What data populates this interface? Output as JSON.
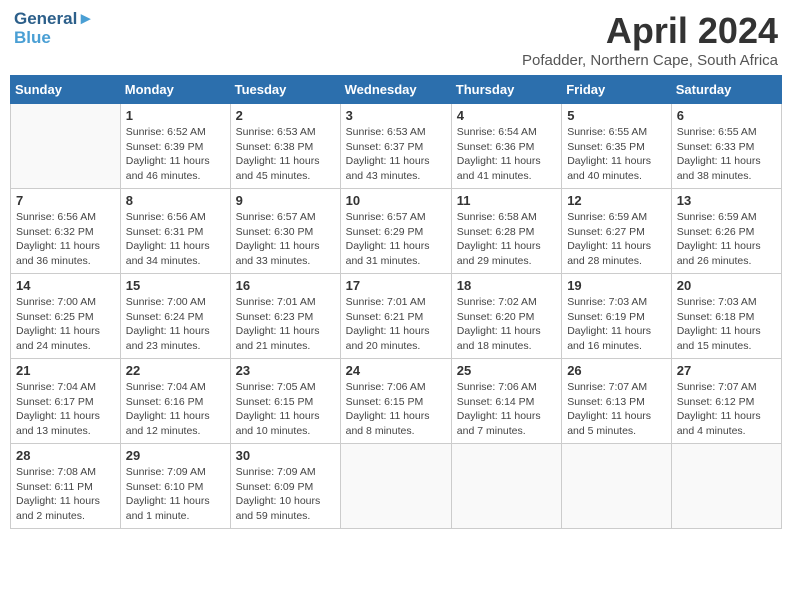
{
  "logo": {
    "line1": "General",
    "line2": "Blue",
    "arrow": "▶"
  },
  "title": "April 2024",
  "location": "Pofadder, Northern Cape, South Africa",
  "days_of_week": [
    "Sunday",
    "Monday",
    "Tuesday",
    "Wednesday",
    "Thursday",
    "Friday",
    "Saturday"
  ],
  "weeks": [
    [
      {
        "day": "",
        "info": ""
      },
      {
        "day": "1",
        "info": "Sunrise: 6:52 AM\nSunset: 6:39 PM\nDaylight: 11 hours\nand 46 minutes."
      },
      {
        "day": "2",
        "info": "Sunrise: 6:53 AM\nSunset: 6:38 PM\nDaylight: 11 hours\nand 45 minutes."
      },
      {
        "day": "3",
        "info": "Sunrise: 6:53 AM\nSunset: 6:37 PM\nDaylight: 11 hours\nand 43 minutes."
      },
      {
        "day": "4",
        "info": "Sunrise: 6:54 AM\nSunset: 6:36 PM\nDaylight: 11 hours\nand 41 minutes."
      },
      {
        "day": "5",
        "info": "Sunrise: 6:55 AM\nSunset: 6:35 PM\nDaylight: 11 hours\nand 40 minutes."
      },
      {
        "day": "6",
        "info": "Sunrise: 6:55 AM\nSunset: 6:33 PM\nDaylight: 11 hours\nand 38 minutes."
      }
    ],
    [
      {
        "day": "7",
        "info": "Sunrise: 6:56 AM\nSunset: 6:32 PM\nDaylight: 11 hours\nand 36 minutes."
      },
      {
        "day": "8",
        "info": "Sunrise: 6:56 AM\nSunset: 6:31 PM\nDaylight: 11 hours\nand 34 minutes."
      },
      {
        "day": "9",
        "info": "Sunrise: 6:57 AM\nSunset: 6:30 PM\nDaylight: 11 hours\nand 33 minutes."
      },
      {
        "day": "10",
        "info": "Sunrise: 6:57 AM\nSunset: 6:29 PM\nDaylight: 11 hours\nand 31 minutes."
      },
      {
        "day": "11",
        "info": "Sunrise: 6:58 AM\nSunset: 6:28 PM\nDaylight: 11 hours\nand 29 minutes."
      },
      {
        "day": "12",
        "info": "Sunrise: 6:59 AM\nSunset: 6:27 PM\nDaylight: 11 hours\nand 28 minutes."
      },
      {
        "day": "13",
        "info": "Sunrise: 6:59 AM\nSunset: 6:26 PM\nDaylight: 11 hours\nand 26 minutes."
      }
    ],
    [
      {
        "day": "14",
        "info": "Sunrise: 7:00 AM\nSunset: 6:25 PM\nDaylight: 11 hours\nand 24 minutes."
      },
      {
        "day": "15",
        "info": "Sunrise: 7:00 AM\nSunset: 6:24 PM\nDaylight: 11 hours\nand 23 minutes."
      },
      {
        "day": "16",
        "info": "Sunrise: 7:01 AM\nSunset: 6:23 PM\nDaylight: 11 hours\nand 21 minutes."
      },
      {
        "day": "17",
        "info": "Sunrise: 7:01 AM\nSunset: 6:21 PM\nDaylight: 11 hours\nand 20 minutes."
      },
      {
        "day": "18",
        "info": "Sunrise: 7:02 AM\nSunset: 6:20 PM\nDaylight: 11 hours\nand 18 minutes."
      },
      {
        "day": "19",
        "info": "Sunrise: 7:03 AM\nSunset: 6:19 PM\nDaylight: 11 hours\nand 16 minutes."
      },
      {
        "day": "20",
        "info": "Sunrise: 7:03 AM\nSunset: 6:18 PM\nDaylight: 11 hours\nand 15 minutes."
      }
    ],
    [
      {
        "day": "21",
        "info": "Sunrise: 7:04 AM\nSunset: 6:17 PM\nDaylight: 11 hours\nand 13 minutes."
      },
      {
        "day": "22",
        "info": "Sunrise: 7:04 AM\nSunset: 6:16 PM\nDaylight: 11 hours\nand 12 minutes."
      },
      {
        "day": "23",
        "info": "Sunrise: 7:05 AM\nSunset: 6:15 PM\nDaylight: 11 hours\nand 10 minutes."
      },
      {
        "day": "24",
        "info": "Sunrise: 7:06 AM\nSunset: 6:15 PM\nDaylight: 11 hours\nand 8 minutes."
      },
      {
        "day": "25",
        "info": "Sunrise: 7:06 AM\nSunset: 6:14 PM\nDaylight: 11 hours\nand 7 minutes."
      },
      {
        "day": "26",
        "info": "Sunrise: 7:07 AM\nSunset: 6:13 PM\nDaylight: 11 hours\nand 5 minutes."
      },
      {
        "day": "27",
        "info": "Sunrise: 7:07 AM\nSunset: 6:12 PM\nDaylight: 11 hours\nand 4 minutes."
      }
    ],
    [
      {
        "day": "28",
        "info": "Sunrise: 7:08 AM\nSunset: 6:11 PM\nDaylight: 11 hours\nand 2 minutes."
      },
      {
        "day": "29",
        "info": "Sunrise: 7:09 AM\nSunset: 6:10 PM\nDaylight: 11 hours\nand 1 minute."
      },
      {
        "day": "30",
        "info": "Sunrise: 7:09 AM\nSunset: 6:09 PM\nDaylight: 10 hours\nand 59 minutes."
      },
      {
        "day": "",
        "info": ""
      },
      {
        "day": "",
        "info": ""
      },
      {
        "day": "",
        "info": ""
      },
      {
        "day": "",
        "info": ""
      }
    ]
  ]
}
